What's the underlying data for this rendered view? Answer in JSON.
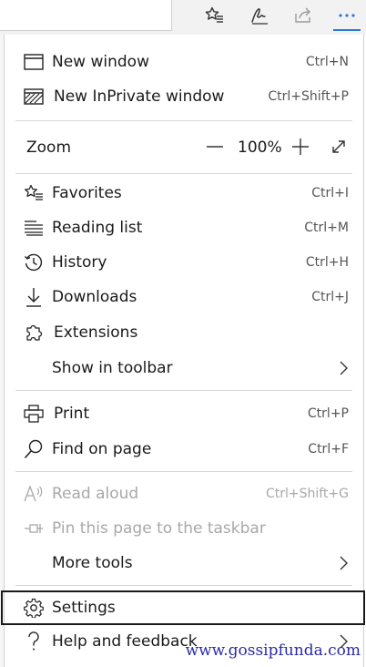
{
  "toolbar": {
    "favorites_icon": "favorites-star-icon",
    "notes_icon": "pen-icon",
    "share_icon": "share-icon",
    "more_icon": "more-dots-icon",
    "accent": "#2b79d6"
  },
  "menu": {
    "new_window": {
      "label": "New window",
      "shortcut": "Ctrl+N"
    },
    "new_inprivate": {
      "label": "New InPrivate window",
      "shortcut": "Ctrl+Shift+P"
    },
    "zoom": {
      "label": "Zoom",
      "value": "100%"
    },
    "favorites": {
      "label": "Favorites",
      "shortcut": "Ctrl+I"
    },
    "reading_list": {
      "label": "Reading list",
      "shortcut": "Ctrl+M"
    },
    "history": {
      "label": "History",
      "shortcut": "Ctrl+H"
    },
    "downloads": {
      "label": "Downloads",
      "shortcut": "Ctrl+J"
    },
    "extensions": {
      "label": "Extensions"
    },
    "show_in_toolbar": {
      "label": "Show in toolbar"
    },
    "print": {
      "label": "Print",
      "shortcut": "Ctrl+P"
    },
    "find_on_page": {
      "label": "Find on page",
      "shortcut": "Ctrl+F"
    },
    "read_aloud": {
      "label": "Read aloud",
      "shortcut": "Ctrl+Shift+G"
    },
    "pin_taskbar": {
      "label": "Pin this page to the taskbar"
    },
    "more_tools": {
      "label": "More tools"
    },
    "settings": {
      "label": "Settings"
    },
    "help": {
      "label": "Help and feedback"
    }
  },
  "watermark": "www.gossipfunda.com"
}
